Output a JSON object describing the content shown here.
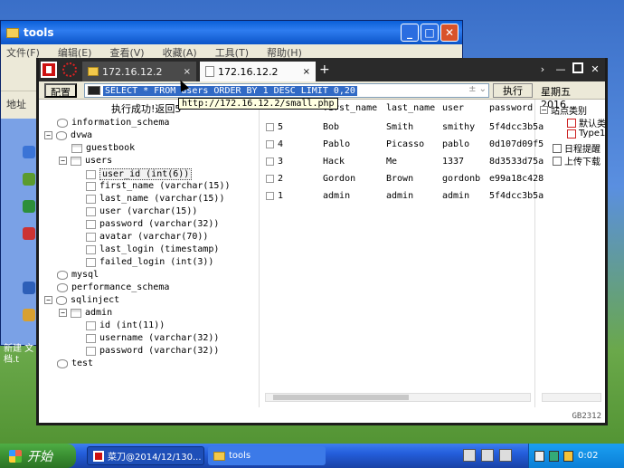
{
  "background_window": {
    "title": "tools",
    "menu": [
      "文件(F)",
      "编辑(E)",
      "查看(V)",
      "收藏(A)",
      "工具(T)",
      "帮助(H)"
    ],
    "address_label": "地址"
  },
  "desktop": {
    "icon_label_1": "新建 文",
    "icon_label_2": "档.t"
  },
  "app": {
    "tabs": [
      {
        "label": "172.16.12.2",
        "close": "×"
      },
      {
        "label": "172.16.12.2",
        "close": "×"
      }
    ],
    "new_tab": "+",
    "ctrl_chevron": "›",
    "ctrl_min": "—",
    "ctrl_close": "✕",
    "toolbar": {
      "config_label": "配置",
      "sql_query": "SELECT * FROM users ORDER BY 1 DESC LIMIT 0,20",
      "sql_dropdown": "±  ⌄",
      "execute_label": "执行",
      "date_text": "星期五 2016..."
    },
    "tooltip": "http://172.16.12.2/small.php",
    "status_message": "执行成功!返回5",
    "tree": {
      "dbs": [
        {
          "name": "information_schema"
        },
        {
          "name": "dvwa"
        },
        {
          "name": "mysql"
        },
        {
          "name": "performance_schema"
        },
        {
          "name": "sqlinject"
        },
        {
          "name": "test"
        }
      ],
      "dvwa_tables": [
        "guestbook",
        "users"
      ],
      "users_columns": [
        "user_id (int(6))",
        "first_name (varchar(15))",
        "last_name (varchar(15))",
        "user (varchar(15))",
        "password (varchar(32))",
        "avatar (varchar(70))",
        "last_login (timestamp)",
        "failed_login (int(3))"
      ],
      "sqlinject_tables": [
        "admin"
      ],
      "admin_columns": [
        "id (int(11))",
        "username (varchar(32))",
        "password (varchar(32))"
      ]
    },
    "grid": {
      "headers": [
        "first_name",
        "last_name",
        "user",
        "password"
      ],
      "rows": [
        {
          "id": "5",
          "first_name": "Bob",
          "last_name": "Smith",
          "user": "smithy",
          "password": "5f4dcc3b5a"
        },
        {
          "id": "4",
          "first_name": "Pablo",
          "last_name": "Picasso",
          "user": "pablo",
          "password": "0d107d09f5"
        },
        {
          "id": "3",
          "first_name": "Hack",
          "last_name": "Me",
          "user": "1337",
          "password": "8d3533d75a"
        },
        {
          "id": "2",
          "first_name": "Gordon",
          "last_name": "Brown",
          "user": "gordonb",
          "password": "e99a18c428"
        },
        {
          "id": "1",
          "first_name": "admin",
          "last_name": "admin",
          "user": "admin",
          "password": "5f4dcc3b5a"
        }
      ]
    },
    "side_panel": {
      "items": [
        "站点类别",
        "默认类",
        "Type1",
        "日程提醒",
        "上传下载"
      ]
    },
    "status_code": "GB2312"
  },
  "taskbar": {
    "start_label": "开始",
    "task_1": "菜刀@2014/12/130...",
    "task_2": "tools",
    "clock": "0:02"
  },
  "colors": {
    "selection_blue": "#316ac5",
    "xp_taskbar": "#245edb",
    "start_green": "#3a8f32"
  }
}
